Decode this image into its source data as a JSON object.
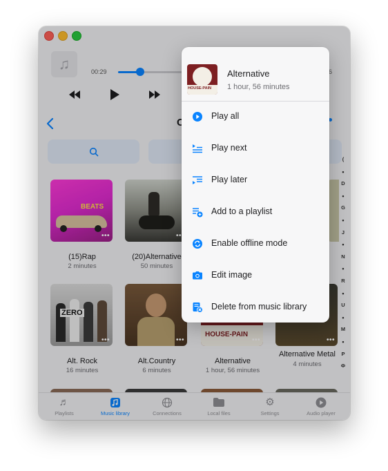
{
  "player": {
    "elapsed": "00:29",
    "remaining_fragment": "6",
    "progress_fraction": 0.29
  },
  "nav": {
    "title_fragment": "C"
  },
  "albums": [
    {
      "title": "(15)Rap",
      "subtitle": "2 minutes",
      "cover_text": "BEATS"
    },
    {
      "title": "(20)Alternative",
      "subtitle": "50 minutes",
      "cover_text": ""
    },
    {
      "title": "Alt. Rock",
      "subtitle": "16 minutes",
      "cover_text": "ZERO"
    },
    {
      "title": "Alt.Country",
      "subtitle": "6 minutes",
      "cover_text": ""
    },
    {
      "title": "Alternative",
      "subtitle": "1 hour, 56 minutes",
      "cover_text": "HOUSE-PAIN"
    },
    {
      "title": "Alternative Metal",
      "subtitle": "4 minutes",
      "cover_text": ""
    }
  ],
  "index_letters": [
    "(",
    "•",
    "D",
    "•",
    "G",
    "•",
    "J",
    "•",
    "N",
    "•",
    "R",
    "•",
    "U",
    "•",
    "M",
    "•",
    "P",
    "Ф"
  ],
  "tabs": [
    {
      "label": "Playlists",
      "icon": "music-note-list-icon"
    },
    {
      "label": "Music library",
      "icon": "music-library-icon"
    },
    {
      "label": "Connections",
      "icon": "globe-icon"
    },
    {
      "label": "Local files",
      "icon": "folder-icon"
    },
    {
      "label": "Settings",
      "icon": "gear-icon"
    },
    {
      "label": "Audio player",
      "icon": "play-circle-icon"
    }
  ],
  "context_menu": {
    "title": "Alternative",
    "subtitle": "1 hour, 56 minutes",
    "cover_text": "HOUSE-PAIN",
    "items": [
      {
        "label": "Play all",
        "icon": "play-circle-icon"
      },
      {
        "label": "Play next",
        "icon": "play-next-icon"
      },
      {
        "label": "Play later",
        "icon": "play-later-icon"
      },
      {
        "label": "Add to a playlist",
        "icon": "add-playlist-icon"
      },
      {
        "label": "Enable offline mode",
        "icon": "sync-icon"
      },
      {
        "label": "Edit image",
        "icon": "camera-icon"
      },
      {
        "label": "Delete from music library",
        "icon": "delete-library-icon"
      }
    ]
  },
  "colors": {
    "accent": "#0a84ff",
    "menu_bg": "#f7f7f8"
  }
}
